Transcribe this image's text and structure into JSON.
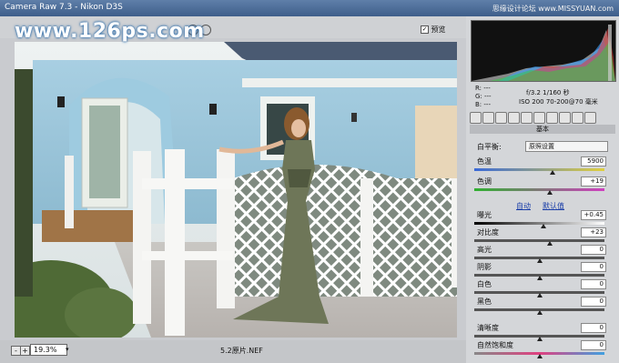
{
  "window": {
    "title": "Camera Raw 7.3  -  Nikon D3S",
    "watermark_top": "思缘设计论坛 www.MISSYUAN.com"
  },
  "watermark": "www.126ps.com",
  "toolbar": {
    "preview_label": "预览",
    "preview_checked": "✓"
  },
  "statusbar": {
    "zoom_value": "19.3%",
    "zoom_minus": "-",
    "zoom_plus": "+",
    "zoom_dropdown": "▾",
    "filename": "5.2原片.NEF"
  },
  "histogram": {
    "rgb": [
      "R: ---",
      "G: ---",
      "B: ---"
    ],
    "exposure": "f/3.2  1/160 秒",
    "camera": "ISO 200   70-200@70 毫米"
  },
  "panel": {
    "section_title": "基本",
    "white_balance_label": "白平衡:",
    "white_balance_value": "原照设置",
    "auto_link": "自动",
    "default_link": "默认值",
    "sliders": [
      {
        "label": "色温",
        "value": "5900",
        "level": 0.6
      },
      {
        "label": "色调",
        "value": "+19",
        "level": 0.58
      },
      {
        "label": "曝光",
        "value": "+0.45",
        "level": 0.53
      },
      {
        "label": "对比度",
        "value": "+23",
        "level": 0.58
      },
      {
        "label": "高光",
        "value": "0",
        "level": 0.5
      },
      {
        "label": "阴影",
        "value": "0",
        "level": 0.5
      },
      {
        "label": "白色",
        "value": "0",
        "level": 0.5
      },
      {
        "label": "黑色",
        "value": "0",
        "level": 0.5
      },
      {
        "label": "清晰度",
        "value": "0",
        "level": 0.5
      },
      {
        "label": "自然饱和度",
        "value": "0",
        "level": 0.5
      }
    ]
  },
  "icons": [
    "zoom-tool-icon",
    "hand-tool-icon",
    "white-balance-tool-icon",
    "rotate-left-icon",
    "rotate-right-icon",
    "basic-tab-icon",
    "tone-curve-tab-icon",
    "detail-tab-icon",
    "hsl-tab-icon",
    "split-toning-tab-icon",
    "lens-tab-icon",
    "effects-tab-icon",
    "camera-calibration-tab-icon",
    "presets-tab-icon",
    "snapshots-tab-icon"
  ]
}
